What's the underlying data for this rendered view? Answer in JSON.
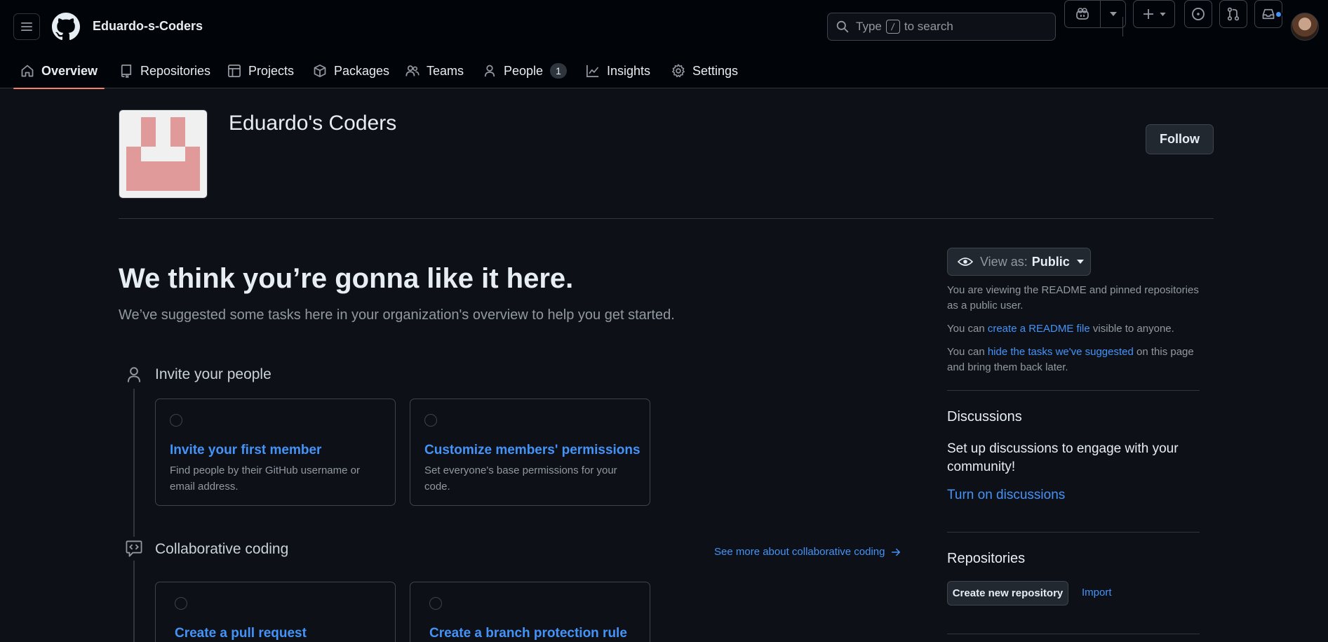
{
  "header": {
    "org_slug": "Eduardo-s-Coders",
    "search_prefix": "Type",
    "search_key": "/",
    "search_suffix": "to search"
  },
  "tabs": [
    {
      "label": "Overview",
      "icon": "home-icon",
      "active": true
    },
    {
      "label": "Repositories",
      "icon": "repo-icon"
    },
    {
      "label": "Projects",
      "icon": "table-icon"
    },
    {
      "label": "Packages",
      "icon": "package-icon"
    },
    {
      "label": "Teams",
      "icon": "people-icon"
    },
    {
      "label": "People",
      "icon": "person-icon",
      "count": "1"
    },
    {
      "label": "Insights",
      "icon": "graph-icon"
    },
    {
      "label": "Settings",
      "icon": "gear-icon"
    }
  ],
  "profile": {
    "name": "Eduardo's Coders",
    "follow_label": "Follow"
  },
  "hero": {
    "title": "We think you’re gonna like it here.",
    "subtitle": "We’ve suggested some tasks here in your organization's overview to help you get started."
  },
  "sections": [
    {
      "title": "Invite your people",
      "icon": "person-icon",
      "cards": [
        {
          "title": "Invite your first member",
          "desc": "Find people by their GitHub username or email address."
        },
        {
          "title": "Customize members' permissions",
          "desc": "Set everyone's base permissions for your code."
        }
      ]
    },
    {
      "title": "Collaborative coding",
      "icon": "code-review-icon",
      "see_more": "See more about collaborative coding",
      "cards": [
        {
          "title": "Create a pull request",
          "desc": ""
        },
        {
          "title": "Create a branch protection rule",
          "desc": ""
        }
      ]
    }
  ],
  "sidebar": {
    "view_as_label": "View as:",
    "view_as_value": "Public",
    "viewing_text": "You are viewing the README and pinned repositories as a public user.",
    "readme_prefix": "You can",
    "readme_link": "create a README file",
    "readme_suffix": "visible to anyone.",
    "hide_prefix": "You can",
    "hide_link": "hide the tasks we've suggested",
    "hide_suffix": "on this page and bring them back later.",
    "discussions_title": "Discussions",
    "discussions_text": "Set up discussions to engage with your community!",
    "discussions_link": "Turn on discussions",
    "repos_title": "Repositories",
    "create_repo_label": "Create new repository",
    "import_label": "Import"
  },
  "colors": {
    "accent": "#4493f8",
    "tab_underline": "#f78166",
    "avatar_pink": "#e09a9a",
    "notification": "#4493f8"
  }
}
